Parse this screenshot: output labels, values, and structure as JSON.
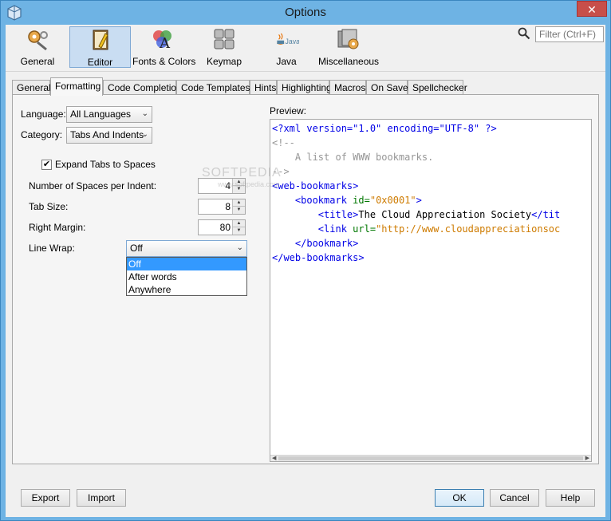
{
  "window": {
    "title": "Options",
    "close_glyph": "✕"
  },
  "categories": [
    {
      "label": "General",
      "icon": "gears-icon"
    },
    {
      "label": "Editor",
      "icon": "editor-icon",
      "selected": true
    },
    {
      "label": "Fonts & Colors",
      "icon": "fonts-colors-icon"
    },
    {
      "label": "Keymap",
      "icon": "keymap-icon"
    },
    {
      "label": "Java",
      "icon": "java-icon"
    },
    {
      "label": "Miscellaneous",
      "icon": "misc-icon"
    }
  ],
  "filter": {
    "placeholder": "Filter (Ctrl+F)"
  },
  "tabs": [
    {
      "label": "General"
    },
    {
      "label": "Formatting",
      "active": true
    },
    {
      "label": "Code Completion"
    },
    {
      "label": "Code Templates"
    },
    {
      "label": "Hints"
    },
    {
      "label": "Highlighting"
    },
    {
      "label": "Macros"
    },
    {
      "label": "On Save"
    },
    {
      "label": "Spellchecker"
    }
  ],
  "form": {
    "language_label": "Language:",
    "language_value": "All Languages",
    "category_label": "Category:",
    "category_value": "Tabs And Indents",
    "expand_tabs_label": "Expand Tabs to Spaces",
    "expand_tabs_checked": true,
    "expand_tabs_mark": "✔",
    "spaces_label": "Number of Spaces per Indent:",
    "spaces_value": "4",
    "tab_size_label": "Tab Size:",
    "tab_size_value": "8",
    "right_margin_label": "Right Margin:",
    "right_margin_value": "80",
    "line_wrap_label": "Line Wrap:",
    "line_wrap_value": "Off",
    "line_wrap_options": [
      "Off",
      "After words",
      "Anywhere"
    ],
    "combo_arrow": "⌄",
    "spin_up": "▲",
    "spin_down": "▼"
  },
  "preview": {
    "label": "Preview:",
    "lines": [
      [
        [
          "c-blue",
          "<?xml version=\"1.0\" encoding=\"UTF-8\" ?>"
        ]
      ],
      [
        [
          "c-gray",
          "<!--"
        ]
      ],
      [
        [
          "c-gray",
          "    A list of WWW bookmarks."
        ]
      ],
      [
        [
          "c-gray",
          "-->"
        ]
      ],
      [
        [
          "c-blue",
          "<web-bookmarks>"
        ]
      ],
      [
        [
          "c-blue",
          "    <bookmark "
        ],
        [
          "c-green",
          "id="
        ],
        [
          "c-orange",
          "\"0x0001\""
        ],
        [
          "c-blue",
          ">"
        ]
      ],
      [
        [
          "c-blue",
          "        <title>"
        ],
        [
          "c-black",
          "The Cloud Appreciation Society"
        ],
        [
          "c-blue",
          "</tit"
        ]
      ],
      [
        [
          "c-blue",
          "        <link "
        ],
        [
          "c-green",
          "url="
        ],
        [
          "c-orange",
          "\"http://www.cloudappreciationsoc"
        ]
      ],
      [
        [
          "c-blue",
          "    </bookmark>"
        ]
      ],
      [
        [
          "c-blue",
          "</web-bookmarks>"
        ]
      ]
    ]
  },
  "watermark": {
    "text": "SOFTPEDIA",
    "sub": "www.softpedia.com"
  },
  "buttons": {
    "export": "Export",
    "import": "Import",
    "ok": "OK",
    "cancel": "Cancel",
    "help": "Help"
  },
  "colors": {
    "title_bar": "#6eb3e4",
    "selection": "#3399ff",
    "close": "#c74f4a"
  }
}
